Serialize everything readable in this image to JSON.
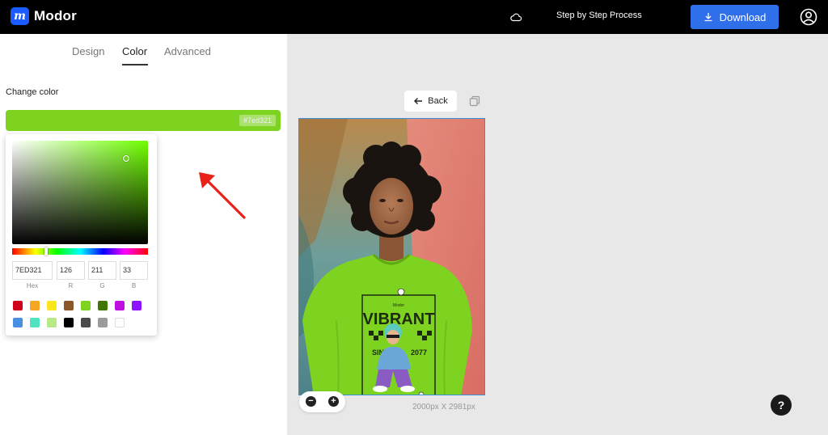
{
  "app": {
    "name": "Modor",
    "logo_letter": "m"
  },
  "header": {
    "step_link": "Step by Step Process",
    "download_label": "Download"
  },
  "tabs": [
    {
      "label": "Design",
      "active": false
    },
    {
      "label": "Color",
      "active": true
    },
    {
      "label": "Advanced",
      "active": false
    }
  ],
  "color_panel": {
    "section_label": "Change color",
    "current_hex": "#7ed321",
    "current_color": "#7ed321",
    "hue_color": "#6fff00"
  },
  "picker": {
    "hex": "7ED321",
    "r": "126",
    "g": "211",
    "b": "33",
    "labels": {
      "hex": "Hex",
      "r": "R",
      "g": "G",
      "b": "B"
    },
    "saturation_pct": 84,
    "value_pct": 83,
    "hue_pct": 25,
    "swatches": [
      "#d0021b",
      "#f5a623",
      "#f8e71c",
      "#8b572a",
      "#7ed321",
      "#417505",
      "#bd10e0",
      "#9013fe",
      "#4a90e2",
      "#50e3c2",
      "#b8e986",
      "#000000",
      "#4a4a4a",
      "#9b9b9b",
      "#ffffff"
    ]
  },
  "canvas": {
    "back_label": "Back",
    "dimensions": "2000px X 2981px",
    "shirt_text": "VIBRANT",
    "shirt_text_2": "SINCE",
    "shirt_text_3": "2077"
  },
  "help_label": "?",
  "colors": {
    "accent": "#2f6fe9",
    "topbar": "#000000",
    "annotation": "#e8211b"
  }
}
